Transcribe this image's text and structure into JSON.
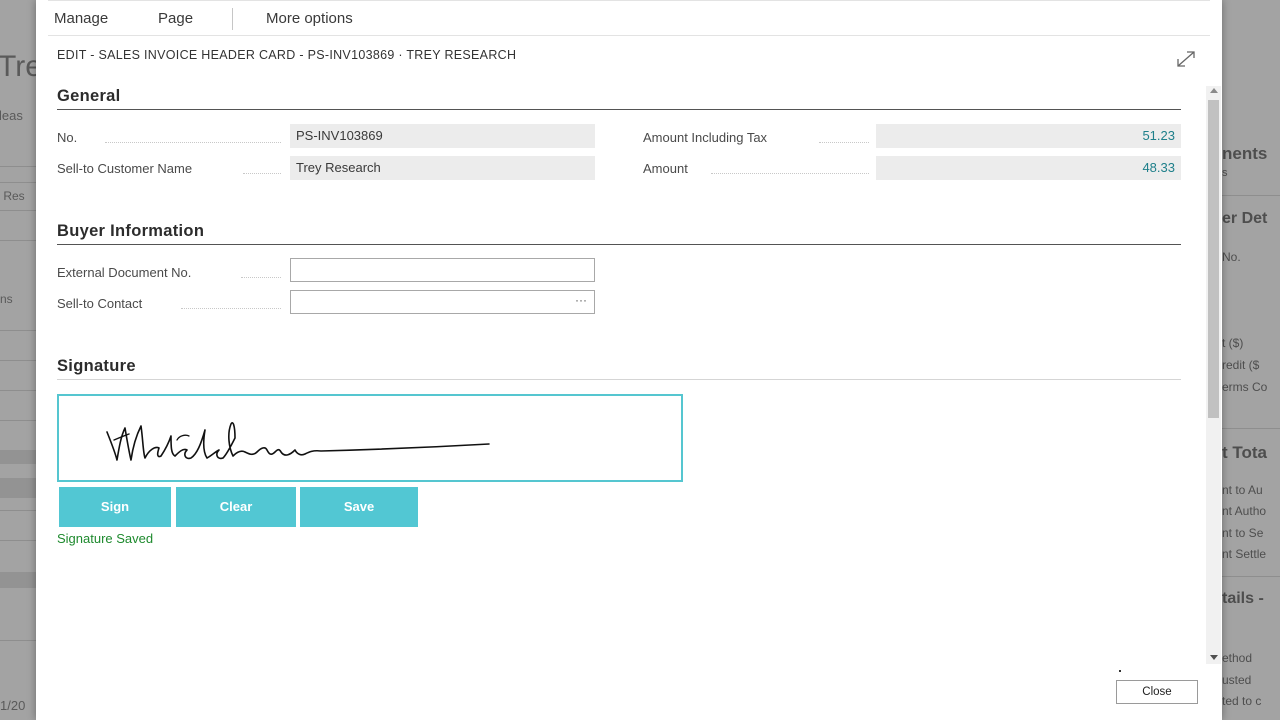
{
  "background": {
    "left_fragments": [
      "Tre",
      "leas",
      "r Res",
      "ns",
      "1/20"
    ],
    "right_fragments": [
      "nents",
      "s",
      "er Det",
      "No.",
      "t ($)",
      "redit ($",
      "erms Co",
      "t Tota",
      "nt to Au",
      "nt Autho",
      "nt to Se",
      "nt Settle",
      "tails -",
      "ethod",
      "usted",
      "ted to c"
    ]
  },
  "dialog": {
    "menu": {
      "manage": "Manage",
      "page": "Page",
      "more_options": "More options"
    },
    "caption": "EDIT - SALES INVOICE HEADER CARD - PS-INV103869 · TREY RESEARCH",
    "expand_icon": "expand-icon",
    "general": {
      "title": "General",
      "no_label": "No.",
      "no_value": "PS-INV103869",
      "customer_label": "Sell-to Customer Name",
      "customer_value": "Trey Research",
      "amount_tax_label": "Amount Including Tax",
      "amount_tax_value": "51.23",
      "amount_label": "Amount",
      "amount_value": "48.33"
    },
    "buyer": {
      "title": "Buyer Information",
      "ext_doc_label": "External Document No.",
      "ext_doc_value": "",
      "contact_label": "Sell-to Contact",
      "contact_value": "",
      "contact_lookup": "···"
    },
    "signature": {
      "title": "Signature",
      "sign_label": "Sign",
      "clear_label": "Clear",
      "save_label": "Save",
      "status": "Signature Saved"
    },
    "close_label": "Close"
  },
  "colors": {
    "accent": "#52c7d3",
    "amount_text": "#1e7f8a",
    "status_green": "#1e8a2e",
    "overlay": "#a3a3a3"
  }
}
